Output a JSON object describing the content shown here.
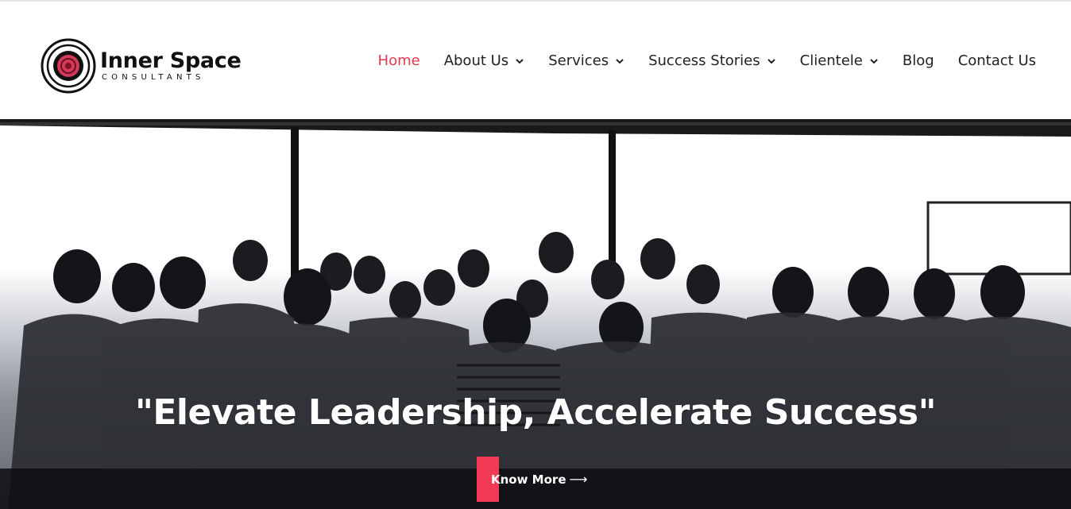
{
  "brand": {
    "name": "Inner Space",
    "tagline": "CONSULTANTS",
    "accent_color": "#e8394d"
  },
  "nav": {
    "items": [
      {
        "label": "Home",
        "active": true,
        "has_dropdown": false
      },
      {
        "label": "About Us",
        "active": false,
        "has_dropdown": true
      },
      {
        "label": "Services",
        "active": false,
        "has_dropdown": true
      },
      {
        "label": "Success Stories",
        "active": false,
        "has_dropdown": true
      },
      {
        "label": "Clientele",
        "active": false,
        "has_dropdown": true
      },
      {
        "label": "Blog",
        "active": false,
        "has_dropdown": false
      },
      {
        "label": "Contact Us",
        "active": false,
        "has_dropdown": false
      }
    ],
    "dropdown_icon": "chevron-down-icon"
  },
  "hero": {
    "headline": "\"Elevate Leadership, Accelerate Success\"",
    "cta_label": "Know More",
    "cta_icon": "arrow-right-icon",
    "cta_color": "#f23a55",
    "image_description_icon": "team-photo"
  }
}
